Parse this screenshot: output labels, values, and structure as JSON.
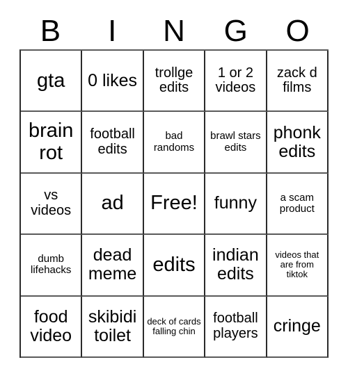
{
  "card": {
    "header": {
      "letters": [
        "B",
        "I",
        "N",
        "G",
        "O"
      ]
    },
    "rows": [
      [
        {
          "text": "gta",
          "size": "fs-xl"
        },
        {
          "text": "0 likes",
          "size": "fs-lg"
        },
        {
          "text": "trollge edits",
          "size": "fs-md"
        },
        {
          "text": "1 or 2 videos",
          "size": "fs-md"
        },
        {
          "text": "zack d films",
          "size": "fs-md"
        }
      ],
      [
        {
          "text": "brain rot",
          "size": "fs-xl"
        },
        {
          "text": "football edits",
          "size": "fs-md"
        },
        {
          "text": "bad randoms",
          "size": "fs-sm"
        },
        {
          "text": "brawl stars edits",
          "size": "fs-sm"
        },
        {
          "text": "phonk edits",
          "size": "fs-lg"
        }
      ],
      [
        {
          "text": "vs videos",
          "size": "fs-md"
        },
        {
          "text": "ad",
          "size": "fs-xl"
        },
        {
          "text": "Free!",
          "size": "fs-xl"
        },
        {
          "text": "funny",
          "size": "fs-lg"
        },
        {
          "text": "a scam product",
          "size": "fs-sm"
        }
      ],
      [
        {
          "text": "dumb lifehacks",
          "size": "fs-sm"
        },
        {
          "text": "dead meme",
          "size": "fs-lg"
        },
        {
          "text": "edits",
          "size": "fs-xl"
        },
        {
          "text": "indian edits",
          "size": "fs-lg"
        },
        {
          "text": "videos that are from tiktok",
          "size": "fs-xs"
        }
      ],
      [
        {
          "text": "food video",
          "size": "fs-lg"
        },
        {
          "text": "skibidi toilet",
          "size": "fs-lg"
        },
        {
          "text": "deck of cards falling chin",
          "size": "fs-xs"
        },
        {
          "text": "football players",
          "size": "fs-md"
        },
        {
          "text": "cringe",
          "size": "fs-lg"
        }
      ]
    ]
  }
}
